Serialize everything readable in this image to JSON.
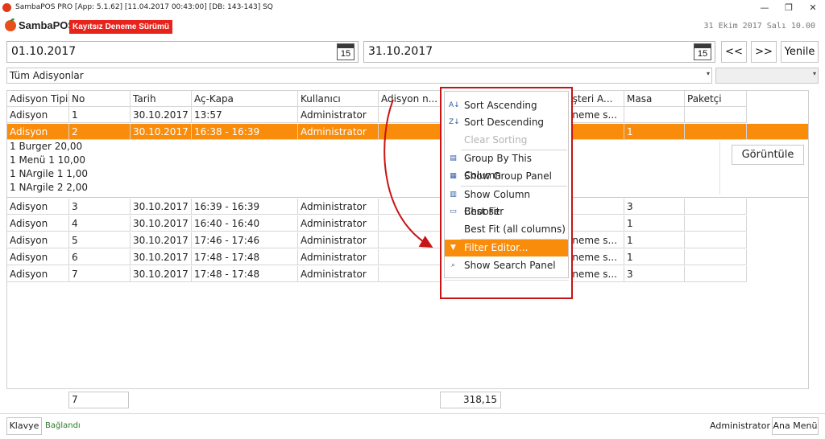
{
  "window": {
    "title": "SambaPOS PRO [App: 5.1.62] [11.04.2017 00:43:00] [DB: 143-143] SQ",
    "minimize": "—",
    "restore": "❐",
    "close": "✕"
  },
  "brand": {
    "name": "SambaPOS",
    "trial_badge": "Kayıtsız Deneme Sürümü",
    "datetime": "31 Ekim 2017 Salı 10.00"
  },
  "dates": {
    "start": "01.10.2017",
    "end": "31.10.2017",
    "calendar_day": "15"
  },
  "nav": {
    "prev": "<<",
    "next": ">>",
    "refresh": "Yenile"
  },
  "filter": {
    "selected": "Tüm Adisyonlar",
    "secondary": ""
  },
  "grid": {
    "columns": [
      "Adisyon Tipi",
      "No",
      "Tarih",
      "Aç-Kapa",
      "Kullanıcı",
      "Adisyon n...",
      "",
      "üşteri A...",
      "Masa",
      "Paketçi"
    ],
    "rows": [
      [
        "Adisyon",
        "1",
        "30.10.2017",
        "13:57",
        "Administrator",
        "",
        "",
        "eneme s...",
        "",
        ""
      ],
      [
        "Adisyon",
        "2",
        "30.10.2017",
        "16:38 - 16:39",
        "Administrator",
        "",
        "",
        "",
        "1",
        ""
      ],
      [
        "Adisyon",
        "3",
        "30.10.2017",
        "16:39 - 16:39",
        "Administrator",
        "",
        "",
        "",
        "3",
        ""
      ],
      [
        "Adisyon",
        "4",
        "30.10.2017",
        "16:40 - 16:40",
        "Administrator",
        "",
        "",
        "",
        "1",
        ""
      ],
      [
        "Adisyon",
        "5",
        "30.10.2017",
        "17:46 - 17:46",
        "Administrator",
        "",
        "",
        "eneme s...",
        "1",
        ""
      ],
      [
        "Adisyon",
        "6",
        "30.10.2017",
        "17:48 - 17:48",
        "Administrator",
        "",
        "",
        "eneme s...",
        "1",
        ""
      ],
      [
        "Adisyon",
        "7",
        "30.10.2017",
        "17:48 - 17:48",
        "Administrator",
        "",
        "",
        "eneme s...",
        "3",
        ""
      ]
    ],
    "detail_lines": [
      "1 Burger 20,00",
      "1 Menü 1 10,00",
      "1 NArgile 1 1,00",
      "1 NArgile 2 2,00"
    ],
    "view_button": "Görüntüle",
    "summary_count": "7",
    "summary_total": "318,15"
  },
  "context_menu": {
    "items": [
      {
        "label": "Sort Ascending",
        "icon": "sort-ascending-icon",
        "glyph": "A↓"
      },
      {
        "label": "Sort Descending",
        "icon": "sort-descending-icon",
        "glyph": "Z↓"
      },
      {
        "label": "Clear Sorting",
        "icon": "clear-sorting-icon",
        "glyph": ""
      },
      {
        "label": "Group By This Column",
        "icon": "group-by-icon",
        "glyph": "▤"
      },
      {
        "label": "Show Group Panel",
        "icon": "group-panel-icon",
        "glyph": "▦"
      },
      {
        "label": "Show Column Chooser",
        "icon": "column-chooser-icon",
        "glyph": "▥"
      },
      {
        "label": "Best Fit",
        "icon": "best-fit-icon",
        "glyph": "▭"
      },
      {
        "label": "Best Fit (all columns)",
        "icon": "",
        "glyph": ""
      },
      {
        "label": "Filter Editor...",
        "icon": "filter-icon",
        "glyph": "▼"
      },
      {
        "label": "Show Search Panel",
        "icon": "search-panel-icon",
        "glyph": "⌕"
      }
    ]
  },
  "status": {
    "keyboard": "Klavye",
    "connection": "Bağlandı",
    "user": "Administrator",
    "main_menu": "Ana Menü"
  }
}
